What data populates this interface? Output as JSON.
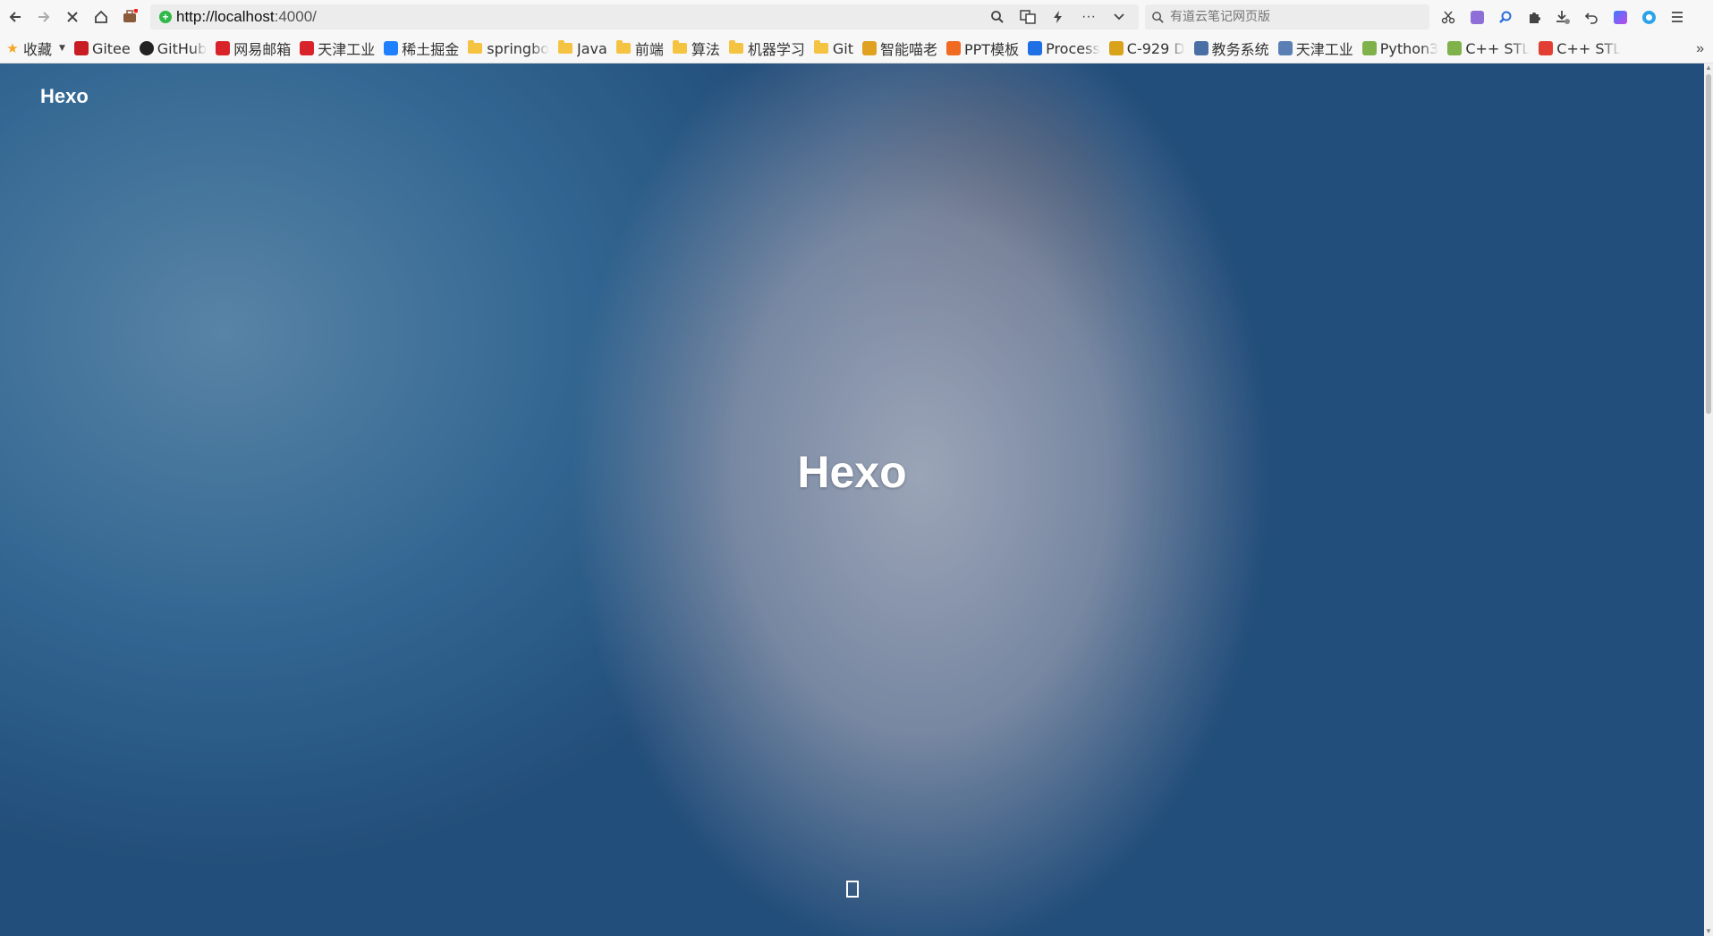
{
  "browser": {
    "url_host": "http://localhost",
    "url_rest": ":4000/",
    "search_placeholder": "有道云笔记网页版",
    "secure_icon": "shield-check-icon"
  },
  "bookmarks": [
    {
      "label": "收藏",
      "icon": "star-icon",
      "color": "#f5a623"
    },
    {
      "label": "Gitee",
      "icon": "gitee-icon",
      "color": "#c71d23"
    },
    {
      "label": "GitHub",
      "icon": "github-icon",
      "color": "#222222"
    },
    {
      "label": "网易邮箱",
      "icon": "netease-mail-icon",
      "color": "#d8232a"
    },
    {
      "label": "天津工业",
      "icon": "tjpu-icon",
      "color": "#d8232a"
    },
    {
      "label": "稀土掘金",
      "icon": "juejin-icon",
      "color": "#1e80ff"
    },
    {
      "label": "springbo",
      "icon": "folder-icon",
      "color": "#f5c342"
    },
    {
      "label": "Java",
      "icon": "folder-icon",
      "color": "#f5c342"
    },
    {
      "label": "前端",
      "icon": "folder-icon",
      "color": "#f5c342"
    },
    {
      "label": "算法",
      "icon": "folder-icon",
      "color": "#f5c342"
    },
    {
      "label": "机器学习",
      "icon": "folder-icon",
      "color": "#f5c342"
    },
    {
      "label": "Git",
      "icon": "folder-icon",
      "color": "#f5c342"
    },
    {
      "label": "智能喵老",
      "icon": "cat-icon",
      "color": "#e0a020"
    },
    {
      "label": "PPT模板",
      "icon": "ppt-icon",
      "color": "#f06a21"
    },
    {
      "label": "Process",
      "icon": "processon-icon",
      "color": "#1f6fe5"
    },
    {
      "label": "C-929 D",
      "icon": "c929-icon",
      "color": "#d9a21b"
    },
    {
      "label": "教务系统",
      "icon": "urp-icon",
      "color": "#4a6fa5"
    },
    {
      "label": "天津工业",
      "icon": "tjpu-icon",
      "color": "#5a7fb5"
    },
    {
      "label": "Python3",
      "icon": "runoob-icon",
      "color": "#7fb24a"
    },
    {
      "label": "C++ STL",
      "icon": "runoob-icon",
      "color": "#7fb24a"
    },
    {
      "label": "C++ STL",
      "icon": "csdn-icon",
      "color": "#e33e33"
    }
  ],
  "page": {
    "brand": "Hexo",
    "title": "Hexo",
    "scroll_icon": "scroll-down-icon"
  }
}
